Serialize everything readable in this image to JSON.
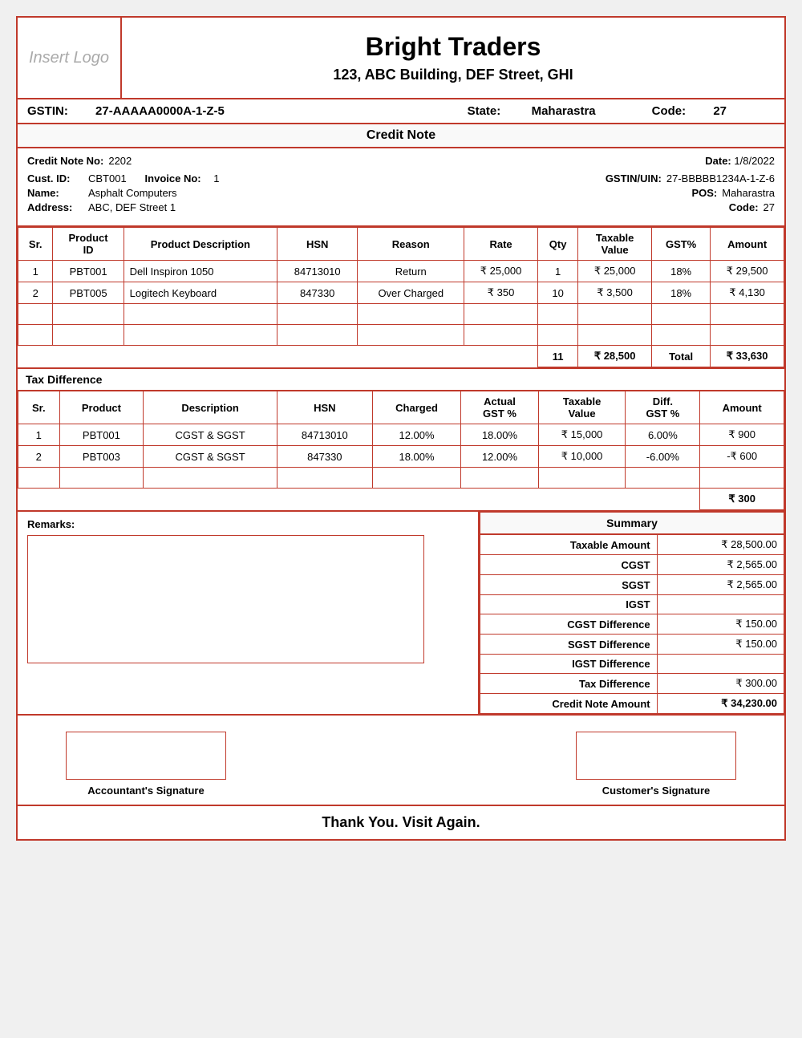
{
  "company": {
    "name": "Bright Traders",
    "address": "123, ABC Building, DEF Street, GHI",
    "gstin": "27-AAAAA0000A-1-Z-5",
    "state": "Maharastra",
    "code": "27",
    "logo_placeholder": "Insert Logo"
  },
  "document": {
    "title": "Credit Note",
    "credit_note_no_label": "Credit Note No:",
    "credit_note_no": "2202",
    "date_label": "Date:",
    "date": "1/8/2022",
    "cust_id_label": "Cust. ID:",
    "cust_id": "CBT001",
    "invoice_no_label": "Invoice No:",
    "invoice_no": "1",
    "name_label": "Name:",
    "name": "Asphalt Computers",
    "gstin_uin_label": "GSTIN/UIN:",
    "gstin_uin": "27-BBBBB1234A-1-Z-6",
    "address_label": "Address:",
    "address": "ABC, DEF Street 1",
    "pos_label": "POS:",
    "pos": "Maharastra",
    "pos_code_label": "Code:",
    "pos_code": "27"
  },
  "items_table": {
    "headers": [
      "Sr.",
      "Product ID",
      "Product Description",
      "HSN",
      "Reason",
      "Rate",
      "Qty",
      "Taxable Value",
      "GST%",
      "Amount"
    ],
    "rows": [
      {
        "sr": "1",
        "product_id": "PBT001",
        "description": "Dell Inspiron 1050",
        "hsn": "84713010",
        "reason": "Return",
        "rate": "₹ 25,000",
        "qty": "1",
        "taxable_value": "₹ 25,000",
        "gst_pct": "18%",
        "amount": "₹ 29,500"
      },
      {
        "sr": "2",
        "product_id": "PBT005",
        "description": "Logitech Keyboard",
        "hsn": "847330",
        "reason": "Over Charged",
        "rate": "₹ 350",
        "qty": "10",
        "taxable_value": "₹ 3,500",
        "gst_pct": "18%",
        "amount": "₹ 4,130"
      }
    ],
    "total_row": {
      "qty": "11",
      "taxable_value": "₹ 28,500",
      "total_label": "Total",
      "amount": "₹ 33,630"
    }
  },
  "tax_diff_section": {
    "title": "Tax Difference",
    "headers": [
      "Sr.",
      "Product",
      "Description",
      "HSN",
      "Charged",
      "Actual GST %",
      "Taxable Value",
      "Diff. GST %",
      "Amount"
    ],
    "rows": [
      {
        "sr": "1",
        "product": "PBT001",
        "description": "CGST & SGST",
        "hsn": "84713010",
        "charged": "12.00%",
        "actual_gst": "18.00%",
        "taxable_value": "₹ 15,000",
        "diff_gst": "6.00%",
        "amount": "₹ 900"
      },
      {
        "sr": "2",
        "product": "PBT003",
        "description": "CGST & SGST",
        "hsn": "847330",
        "charged": "18.00%",
        "actual_gst": "12.00%",
        "taxable_value": "₹ 10,000",
        "diff_gst": "-6.00%",
        "amount": "-₹ 600"
      }
    ],
    "total_amount": "₹ 300"
  },
  "summary": {
    "title": "Summary",
    "rows": [
      {
        "label": "Taxable Amount",
        "value": "₹ 28,500.00"
      },
      {
        "label": "CGST",
        "value": "₹ 2,565.00"
      },
      {
        "label": "SGST",
        "value": "₹ 2,565.00"
      },
      {
        "label": "IGST",
        "value": ""
      },
      {
        "label": "CGST Difference",
        "value": "₹ 150.00"
      },
      {
        "label": "SGST Difference",
        "value": "₹ 150.00"
      },
      {
        "label": "IGST Difference",
        "value": ""
      },
      {
        "label": "Tax Difference",
        "value": "₹ 300.00"
      },
      {
        "label": "Credit Note Amount",
        "value": "₹ 34,230.00"
      }
    ]
  },
  "remarks": {
    "label": "Remarks:"
  },
  "signatures": {
    "accountant": "Accountant's Signature",
    "customer": "Customer's Signature"
  },
  "footer": {
    "text": "Thank You. Visit Again."
  },
  "labels": {
    "gstin_prefix": "GSTIN:",
    "state_prefix": "State:",
    "code_prefix": "Code:"
  }
}
